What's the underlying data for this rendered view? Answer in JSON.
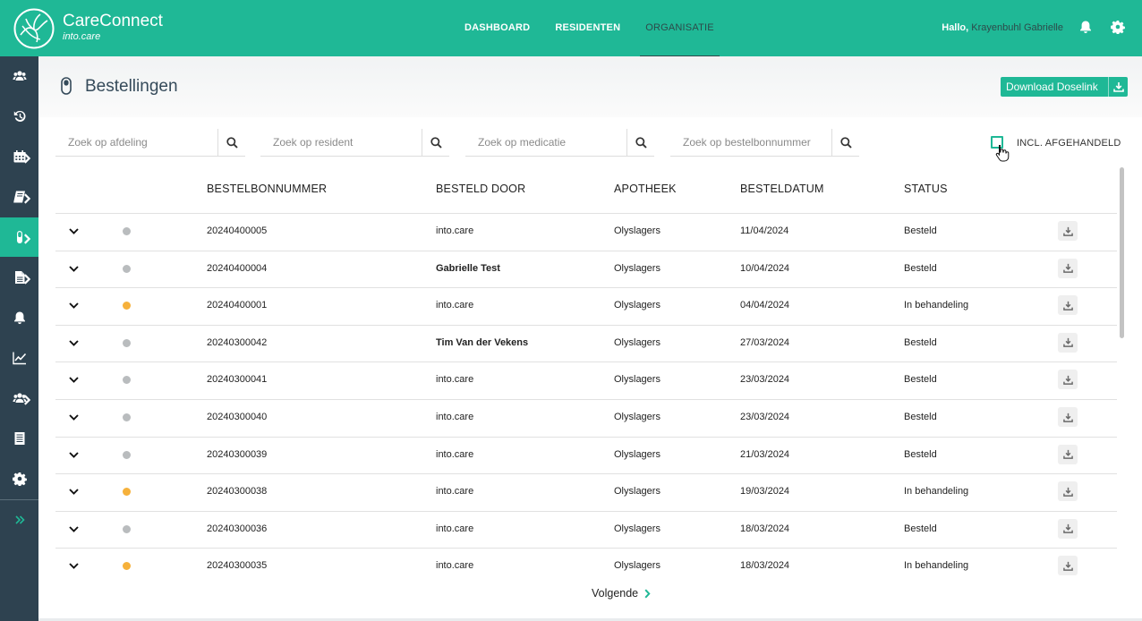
{
  "app": {
    "name": "CareConnect",
    "sub": "into.care"
  },
  "nav": [
    {
      "label": "DASHBOARD",
      "active": false
    },
    {
      "label": "RESIDENTEN",
      "active": false
    },
    {
      "label": "ORGANISATIE",
      "active": true
    }
  ],
  "user": {
    "greeting": "Hallo,",
    "name": "Krayenbuhl Gabrielle"
  },
  "page": {
    "title": "Bestellingen",
    "download_label": "Download Doselink"
  },
  "search": {
    "afdeling": "Zoek op afdeling",
    "resident": "Zoek op resident",
    "medicatie": "Zoek op medicatie",
    "bestelbon": "Zoek op bestelbonnummer"
  },
  "filter": {
    "label": "INCL. AFGEHANDELD",
    "checked": false
  },
  "table": {
    "columns": [
      "BESTELBONNUMMER",
      "BESTELD DOOR",
      "APOTHEEK",
      "BESTELDATUM",
      "STATUS"
    ],
    "rows": [
      {
        "nummer": "20240400005",
        "door": "into.care",
        "bold": false,
        "apotheek": "Olyslagers",
        "datum": "11/04/2024",
        "status": "Besteld",
        "dot": "#b9bcbe"
      },
      {
        "nummer": "20240400004",
        "door": "Gabrielle Test",
        "bold": true,
        "apotheek": "Olyslagers",
        "datum": "10/04/2024",
        "status": "Besteld",
        "dot": "#b9bcbe"
      },
      {
        "nummer": "20240400001",
        "door": "into.care",
        "bold": false,
        "apotheek": "Olyslagers",
        "datum": "04/04/2024",
        "status": "In behandeling",
        "dot": "#f6b13b"
      },
      {
        "nummer": "20240300042",
        "door": "Tim Van der Vekens",
        "bold": true,
        "apotheek": "Olyslagers",
        "datum": "27/03/2024",
        "status": "Besteld",
        "dot": "#b9bcbe"
      },
      {
        "nummer": "20240300041",
        "door": "into.care",
        "bold": false,
        "apotheek": "Olyslagers",
        "datum": "23/03/2024",
        "status": "Besteld",
        "dot": "#b9bcbe"
      },
      {
        "nummer": "20240300040",
        "door": "into.care",
        "bold": false,
        "apotheek": "Olyslagers",
        "datum": "23/03/2024",
        "status": "Besteld",
        "dot": "#b9bcbe"
      },
      {
        "nummer": "20240300039",
        "door": "into.care",
        "bold": false,
        "apotheek": "Olyslagers",
        "datum": "21/03/2024",
        "status": "Besteld",
        "dot": "#b9bcbe"
      },
      {
        "nummer": "20240300038",
        "door": "into.care",
        "bold": false,
        "apotheek": "Olyslagers",
        "datum": "19/03/2024",
        "status": "In behandeling",
        "dot": "#f6b13b"
      },
      {
        "nummer": "20240300036",
        "door": "into.care",
        "bold": false,
        "apotheek": "Olyslagers",
        "datum": "18/03/2024",
        "status": "Besteld",
        "dot": "#b9bcbe"
      },
      {
        "nummer": "20240300035",
        "door": "into.care",
        "bold": false,
        "apotheek": "Olyslagers",
        "datum": "18/03/2024",
        "status": "In behandeling",
        "dot": "#f6b13b"
      }
    ]
  },
  "pagination": {
    "next_label": "Volgende"
  },
  "sidebar": [
    {
      "icon": "users-icon",
      "has_sub": false,
      "active": false
    },
    {
      "icon": "history-icon",
      "has_sub": false,
      "active": false
    },
    {
      "icon": "calendar-icon",
      "has_sub": true,
      "active": false
    },
    {
      "icon": "book-icon",
      "has_sub": true,
      "active": false
    },
    {
      "icon": "pill-icon",
      "has_sub": true,
      "active": true
    },
    {
      "icon": "document-icon",
      "has_sub": true,
      "active": false
    },
    {
      "icon": "bell-icon",
      "has_sub": false,
      "active": false
    },
    {
      "icon": "chart-icon",
      "has_sub": false,
      "active": false
    },
    {
      "icon": "team-icon",
      "has_sub": true,
      "active": false
    },
    {
      "icon": "ledger-icon",
      "has_sub": false,
      "active": false
    },
    {
      "icon": "gear-icon",
      "has_sub": false,
      "active": false
    },
    {
      "icon": "expand-icon",
      "has_sub": false,
      "active": false
    }
  ],
  "colors": {
    "brand": "#1fb896",
    "sidebar": "#2e4250",
    "pending": "#f6b13b",
    "done": "#b9bcbe"
  }
}
